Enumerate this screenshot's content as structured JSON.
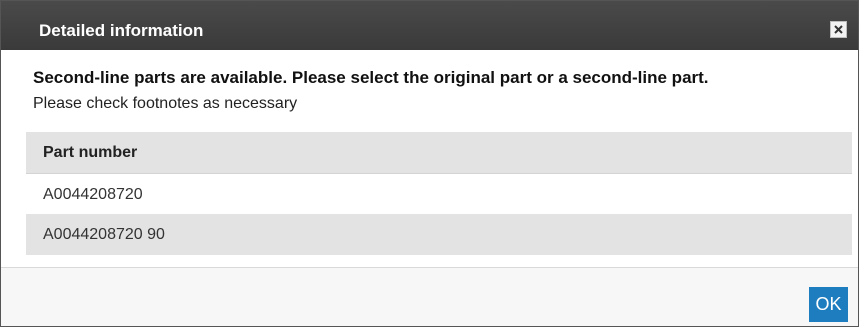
{
  "dialog": {
    "title": "Detailed information",
    "close_icon": "close-icon",
    "message": "Second-line parts are available. Please select the original part or a second-line part.",
    "note": "Please check footnotes as necessary",
    "table": {
      "header": "Part number",
      "rows": [
        "A0044208720",
        "A0044208720 90"
      ]
    },
    "ok_label": "OK"
  },
  "colors": {
    "titlebar": "#3f3f3f",
    "ok_button": "#1e7dbf",
    "row_shade": "#e3e3e3"
  }
}
